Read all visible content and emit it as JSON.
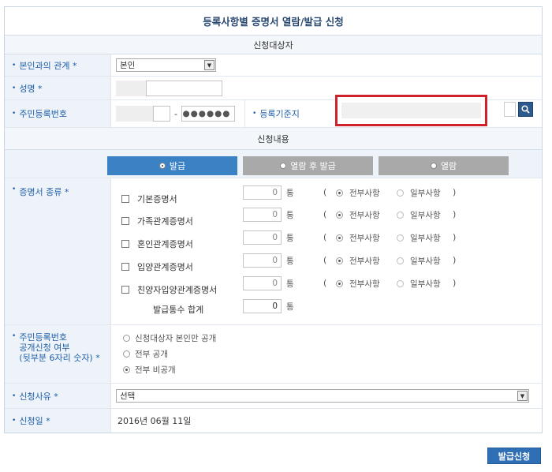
{
  "title": "등록사항별 증명서 열람/발급 신청",
  "section_applicant": "신청대상자",
  "section_content": "신청내용",
  "relation": {
    "label": "본인과의 관계 *",
    "value": "본인"
  },
  "name_field": {
    "label": "성명 *"
  },
  "rrn": {
    "label": "주민등록번호",
    "separator": "-",
    "back_masked": "●●●●●●"
  },
  "base_address": {
    "label": "등록기준지"
  },
  "tabs": [
    {
      "label": "발급",
      "active": true
    },
    {
      "label": "열람 후 발급",
      "active": false
    },
    {
      "label": "열람",
      "active": false
    }
  ],
  "cert_types": {
    "label": "증명서 종류 *",
    "items": [
      {
        "name": "기본증명서",
        "qty": "0"
      },
      {
        "name": "가족관계증명서",
        "qty": "0"
      },
      {
        "name": "혼인관계증명서",
        "qty": "0"
      },
      {
        "name": "입양관계증명서",
        "qty": "0"
      },
      {
        "name": "친양자입양관계증명서",
        "qty": "0"
      }
    ],
    "unit": "통",
    "paren_open": "(",
    "paren_close": ")",
    "opt_full": "전부사항",
    "opt_partial": "일부사항",
    "total_label": "발급통수 합계",
    "total_value": "0"
  },
  "disclosure": {
    "label_line1": "주민등록번호",
    "label_line2": "공개신청 여부",
    "label_line3": "(뒷부분 6자리 숫자) *",
    "options": [
      "신청대상자 본인만 공개",
      "전부 공개",
      "전부 비공개"
    ],
    "selected": 2
  },
  "reason": {
    "label": "신청사유 *",
    "value": "선택"
  },
  "date": {
    "label": "신청일 *",
    "value": "2016년 06월 11일"
  },
  "submit_label": "발급신청",
  "colors": {
    "accent": "#3b82c4",
    "label_text": "#1f5fa8",
    "highlight_box": "#d0202a"
  }
}
